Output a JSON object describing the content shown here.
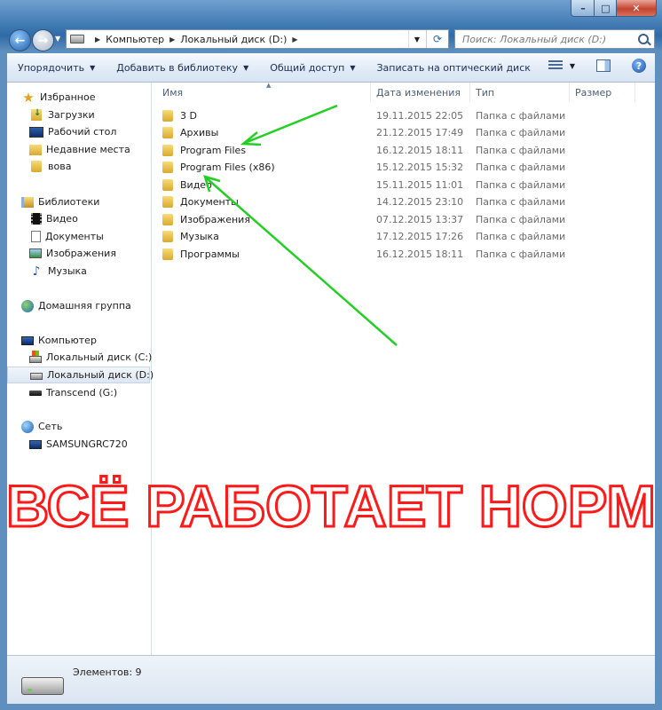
{
  "addressbar": {
    "crumbs": [
      "Компьютер",
      "Локальный диск (D:)"
    ],
    "search_placeholder": "Поиск: Локальный диск (D:)"
  },
  "toolbar": {
    "organize": "Упорядочить",
    "add_to_library": "Добавить в библиотеку",
    "share": "Общий доступ",
    "burn": "Записать на оптический диск"
  },
  "nav": {
    "favorites": "Избранное",
    "downloads": "Загрузки",
    "desktop": "Рабочий стол",
    "recent": "Недавние места",
    "vova": "вова",
    "libraries": "Библиотеки",
    "video": "Видео",
    "documents": "Документы",
    "images": "Изображения",
    "music": "Музыка",
    "homegroup": "Домашняя группа",
    "computer": "Компьютер",
    "drive_c": "Локальный диск (C:)",
    "drive_d": "Локальный диск  (D:)",
    "drive_g": "Transcend (G:)",
    "network": "Сеть",
    "network_pc": "SAMSUNGRC720"
  },
  "columns": {
    "name": "Имя",
    "date": "Дата изменения",
    "type": "Тип",
    "size": "Размер"
  },
  "files": [
    {
      "name": "3 D",
      "date": "19.11.2015 22:05",
      "type": "Папка с файлами"
    },
    {
      "name": "Архивы",
      "date": "21.12.2015 17:49",
      "type": "Папка с файлами"
    },
    {
      "name": "Program Files",
      "date": "16.12.2015 18:11",
      "type": "Папка с файлами"
    },
    {
      "name": "Program Files (x86)",
      "date": "15.12.2015 15:32",
      "type": "Папка с файлами"
    },
    {
      "name": "Видео",
      "date": "15.11.2015 11:01",
      "type": "Папка с файлами"
    },
    {
      "name": "Документы",
      "date": "14.12.2015 23:10",
      "type": "Папка с файлами"
    },
    {
      "name": "Изображения",
      "date": "07.12.2015 13:37",
      "type": "Папка с файлами"
    },
    {
      "name": "Музыка",
      "date": "17.12.2015 17:26",
      "type": "Папка с файлами"
    },
    {
      "name": "Программы",
      "date": "16.12.2015 18:11",
      "type": "Папка с файлами"
    }
  ],
  "overlay": {
    "caption": "ВСЁ РАБОТАЕТ НОРМ",
    "caption_color": "#ff1a1a",
    "arrow_color": "#22d022"
  },
  "status": {
    "items": "Элементов: 9"
  }
}
